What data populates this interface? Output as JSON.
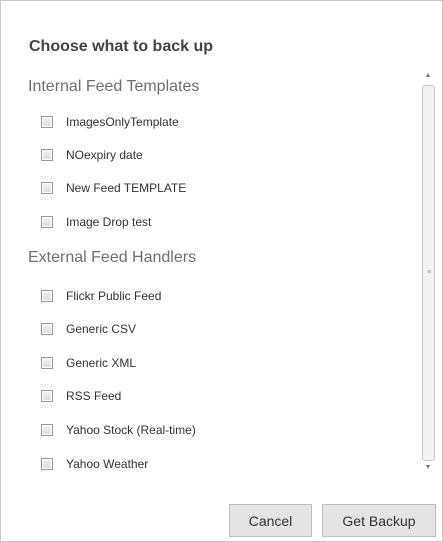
{
  "dialog": {
    "title": "Choose what to back up"
  },
  "sections": [
    {
      "header": "Internal Feed Templates",
      "items": [
        "ImagesOnlyTemplate",
        "NOexpiry date",
        "New Feed TEMPLATE",
        "Image Drop test"
      ]
    },
    {
      "header": "External Feed Handlers",
      "items": [
        "Flickr Public Feed",
        "Generic CSV",
        "Generic XML",
        "RSS Feed",
        "Yahoo Stock (Real-time)",
        "Yahoo Weather"
      ]
    }
  ],
  "buttons": {
    "cancel": "Cancel",
    "backup": "Get Backup"
  },
  "icons": {
    "scroll_up": "scroll-up-arrow-icon",
    "scroll_down": "scroll-down-arrow-icon"
  }
}
